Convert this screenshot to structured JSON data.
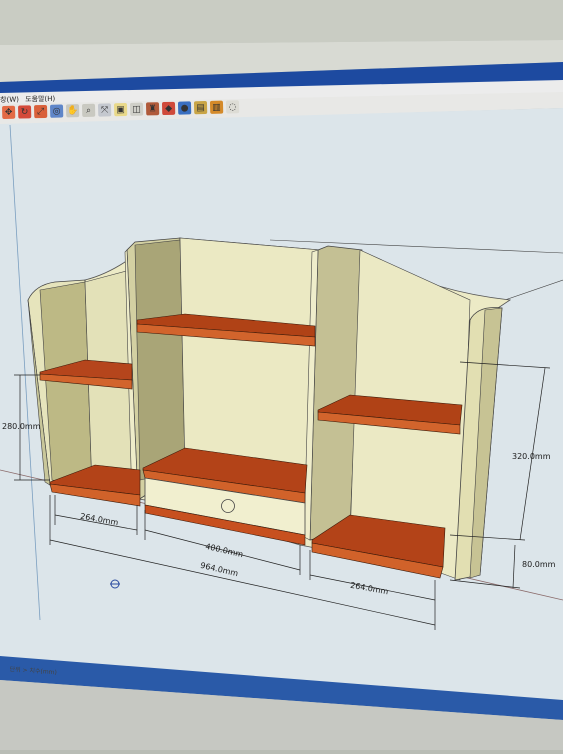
{
  "menu": {
    "items": [
      "창(W)",
      "도움말(H)"
    ]
  },
  "toolbar": {
    "icons": [
      "move-icon",
      "rotate-icon",
      "scale-icon",
      "orbit-icon",
      "pan-icon",
      "zoom-icon",
      "zoom-extents-icon",
      "camera-icon",
      "component-icon",
      "paint-icon",
      "material-icon",
      "shadow-icon",
      "layers-icon",
      "outliner-icon",
      "style-icon",
      "fog-icon"
    ]
  },
  "dimensions": {
    "left_shelf_height": "280.0mm",
    "right_height": "320.0mm",
    "base_height": "80.0mm",
    "left_width": "264.0mm",
    "center_width": "400.0mm",
    "total_width": "964.0mm",
    "right_width": "264.0mm"
  },
  "status": {
    "text": "단위 > 치수(mm)"
  },
  "colors": {
    "board_light": "#eae9c4",
    "board_mid": "#d8d6a8",
    "board_shadow": "#b8b68a",
    "shelf_wood": "#b5451c",
    "shelf_edge": "#8a3515",
    "canvas_bg": "#dde6ec",
    "screen_frame": "#1a4a9c"
  }
}
